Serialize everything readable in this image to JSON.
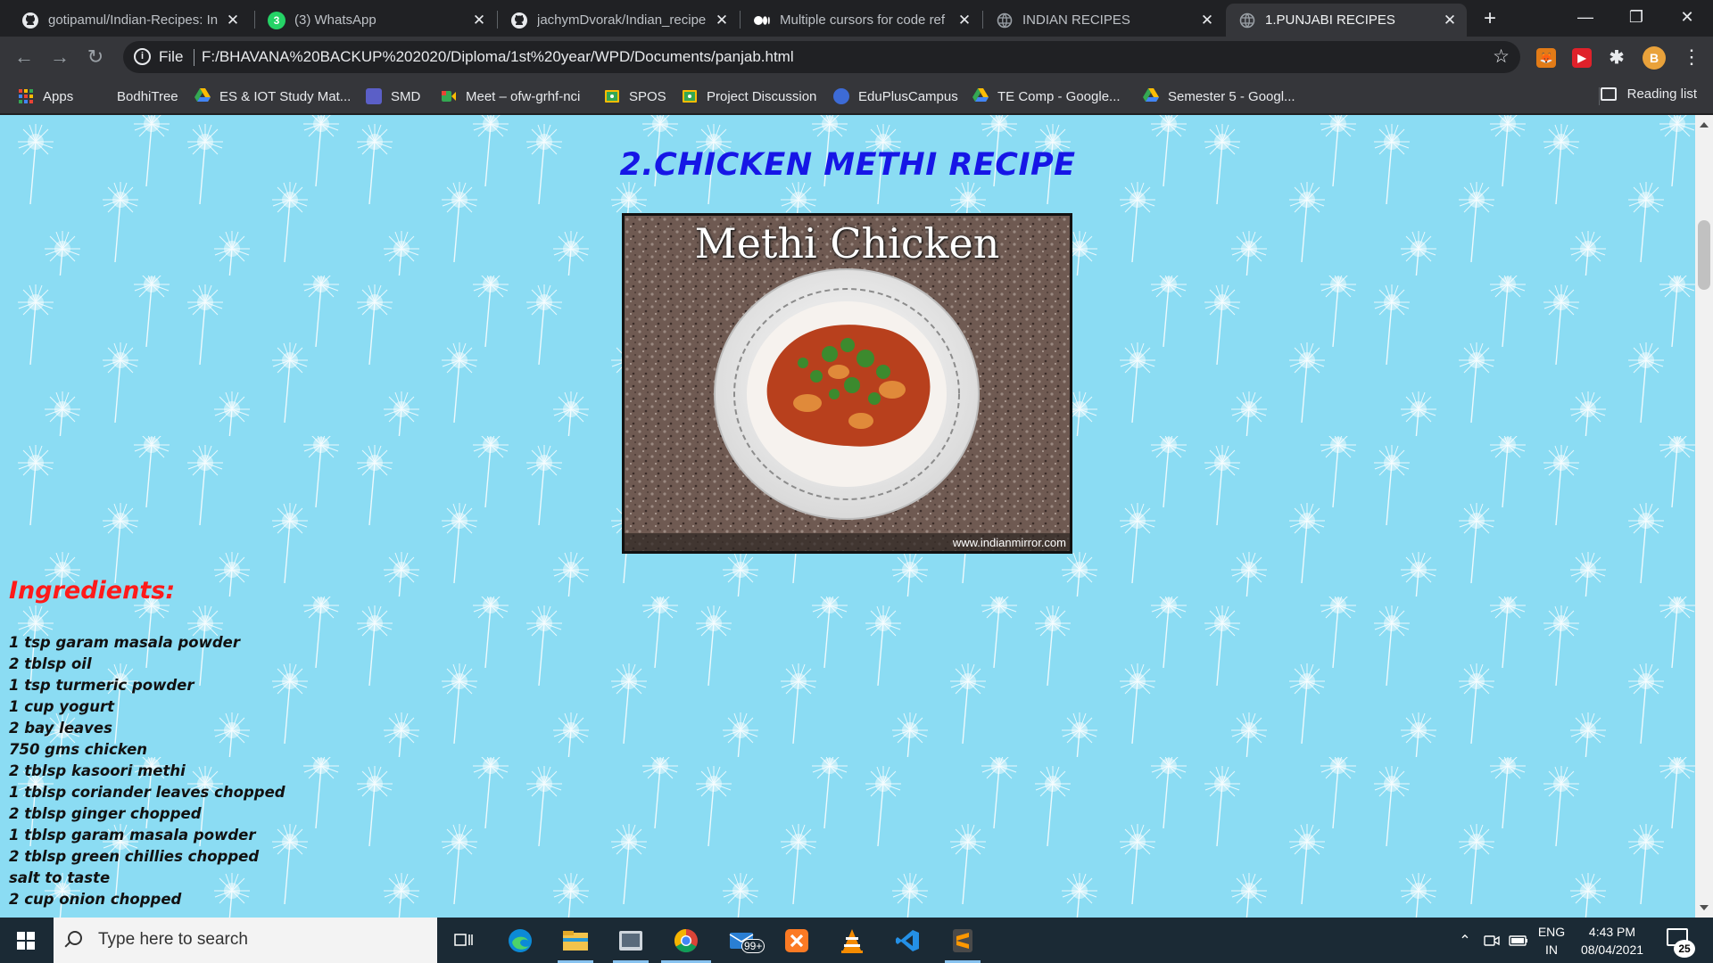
{
  "browser": {
    "tabs": [
      {
        "title": "gotipamul/Indian-Recipes: In",
        "icon": "github-icon",
        "active": false
      },
      {
        "title": "(3) WhatsApp",
        "icon": "whatsapp-icon",
        "badge": "3",
        "active": false
      },
      {
        "title": "jachymDvorak/Indian_recipe",
        "icon": "github-icon",
        "active": false
      },
      {
        "title": "Multiple cursors for code ref",
        "icon": "medium-icon",
        "active": false
      },
      {
        "title": "INDIAN RECIPES",
        "icon": "globe-icon",
        "active": false
      },
      {
        "title": "1.PUNJABI RECIPES",
        "icon": "globe-icon",
        "active": true
      }
    ],
    "address": {
      "scheme_label": "File",
      "url": "F:/BHAVANA%20BACKUP%202020/Diploma/1st%20year/WPD/Documents/panjab.html"
    },
    "bookmarks": [
      {
        "label": "Apps",
        "icon": "apps-grid-icon"
      },
      {
        "label": "BodhiTree",
        "icon": "none"
      },
      {
        "label": "ES & IOT Study Mat...",
        "icon": "google-drive-icon"
      },
      {
        "label": "SMD",
        "icon": "teams-icon"
      },
      {
        "label": "Meet – ofw-grhf-nci",
        "icon": "google-meet-icon"
      },
      {
        "label": "SPOS",
        "icon": "google-classroom-icon"
      },
      {
        "label": "Project Discussion",
        "icon": "google-classroom-icon"
      },
      {
        "label": "EduPlusCampus",
        "icon": "eduplus-icon"
      },
      {
        "label": "TE Comp - Google...",
        "icon": "google-drive-icon"
      },
      {
        "label": "Semester 5 - Googl...",
        "icon": "google-drive-icon"
      }
    ],
    "reading_list_label": "Reading list",
    "profile_initial": "B"
  },
  "page": {
    "heading": "2.CHICKEN METHI RECIPE",
    "image": {
      "title": "Methi Chicken",
      "caption": "www.indianmirror.com"
    },
    "ingredients_heading": "Ingredients:",
    "ingredients": [
      "1 tsp garam masala powder",
      "2 tblsp oil",
      "1 tsp turmeric powder",
      "1 cup yogurt",
      "2 bay leaves",
      "750 gms chicken",
      "2 tblsp kasoori methi",
      "1 tblsp coriander leaves chopped",
      "2 tblsp ginger chopped",
      "1 tblsp garam masala powder",
      "2 tblsp green chillies chopped",
      "salt to taste",
      "2 cup onion chopped"
    ]
  },
  "taskbar": {
    "search_placeholder": "Type here to search",
    "mail_badge": "99+",
    "language": {
      "line1": "ENG",
      "line2": "IN"
    },
    "clock": {
      "time": "4:43 PM",
      "date": "08/04/2021"
    },
    "notification_count": "25"
  },
  "colors": {
    "page_background": "#8bdcf3",
    "heading": "#1616e6",
    "ingredients_heading": "#ff1a1a"
  }
}
